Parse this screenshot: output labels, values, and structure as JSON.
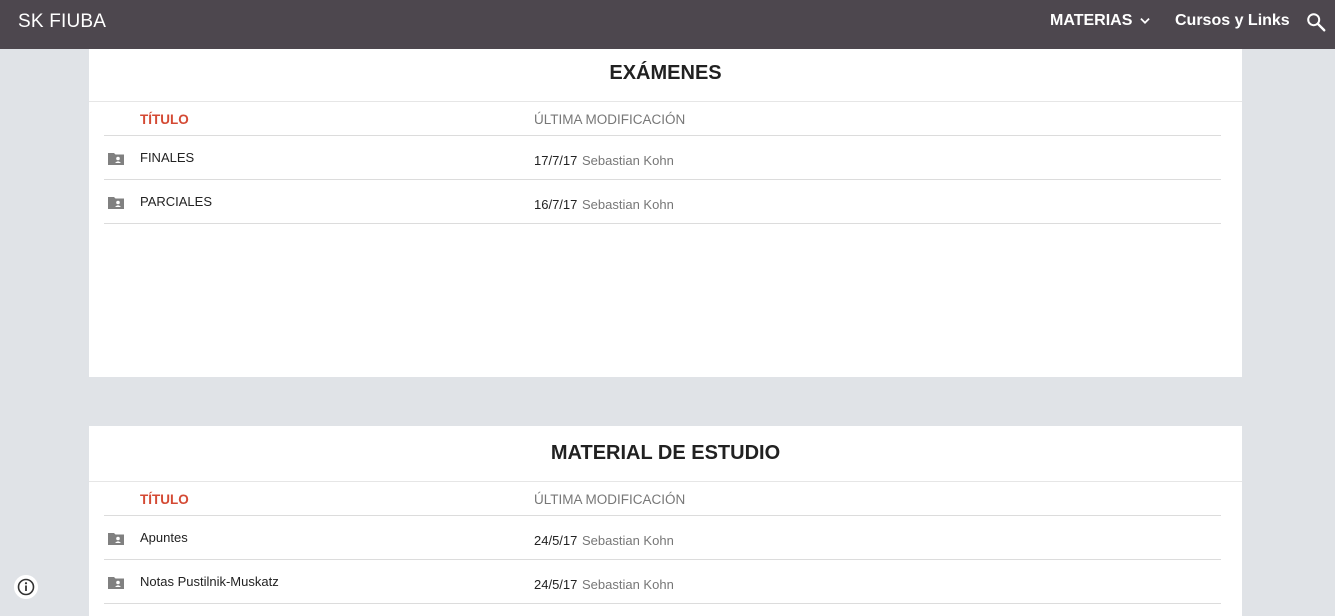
{
  "header": {
    "site_title": "SK FIUBA",
    "nav": [
      {
        "label": "MATERIAS"
      },
      {
        "label": "Cursos y Links"
      }
    ]
  },
  "sections": [
    {
      "title": "EXÁMENES",
      "col_title": "TÍTULO",
      "col_modified": "ÚLTIMA MODIFICACIÓN",
      "rows": [
        {
          "name": "FINALES",
          "date": "17/7/17",
          "author": "Sebastian Kohn"
        },
        {
          "name": "PARCIALES",
          "date": "16/7/17",
          "author": "Sebastian Kohn"
        }
      ]
    },
    {
      "title": "MATERIAL DE ESTUDIO",
      "col_title": "TÍTULO",
      "col_modified": "ÚLTIMA MODIFICACIÓN",
      "rows": [
        {
          "name": "Apuntes",
          "date": "24/5/17",
          "author": "Sebastian Kohn"
        },
        {
          "name": "Notas Pustilnik-Muskatz",
          "date": "24/5/17",
          "author": "Sebastian Kohn"
        }
      ]
    }
  ],
  "colors": {
    "topbar": "#4d474e",
    "background": "#e0e3e7",
    "accent": "#d44a34"
  },
  "icons": [
    "chevron-down-icon",
    "search-icon",
    "shared-folder-icon",
    "info-icon"
  ]
}
